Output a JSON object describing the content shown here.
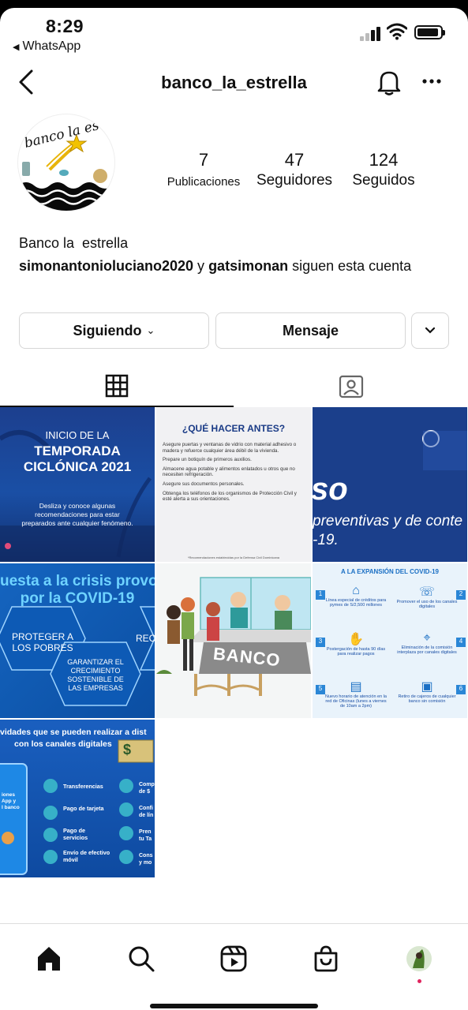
{
  "status_bar": {
    "time": "8:29",
    "back_app": "WhatsApp"
  },
  "header": {
    "username": "banco_la_estrella"
  },
  "profile": {
    "avatar_text": "banco la estrella",
    "stats": [
      {
        "value": "7",
        "label": "Publicaciones"
      },
      {
        "value": "47",
        "label": "Seguidores"
      },
      {
        "value": "124",
        "label": "Seguidos"
      }
    ],
    "name": "Banco la  estrella",
    "followed_by": {
      "user1": "simonantonioluciano2020",
      "connector": " y ",
      "user2": "gatsimonan",
      "suffix": " siguen esta cuenta"
    }
  },
  "buttons": {
    "following": "Siguiendo",
    "message": "Mensaje"
  },
  "posts": {
    "p1": {
      "line1": "INICIO DE LA",
      "line2": "TEMPORADA",
      "line3": "CICLÓNICA 2021",
      "body1": "Desliza y conoce algunas",
      "body2": "recomendaciones  para estar",
      "body3": "preparados ante cualquier fenómeno."
    },
    "p2": {
      "title": "¿QUÉ HACER ANTES?",
      "items": [
        "Asegure puertas y ventanas de vidrio con material adhesivo o madera y refuerce cualquier área débil de la vivienda.",
        "Prepare un botiquín de primeros auxilios.",
        "Almacene agua potable y alimentos enlatados u otros que no necesiten refrigeración.",
        "Asegure sus documentos personales.",
        "Obtenga los teléfonos de los organismos de Protección Civil y esté alerta a sus orientaciones."
      ],
      "footer": "*Recomendaciones establecidas por la Defensa Civil Dominicana"
    },
    "p3": {
      "big": "so",
      "line1": "preventivas y de conte",
      "line2": "-19."
    },
    "p4": {
      "title1": "uesta a la crisis provo",
      "title2": "por la COVID-19",
      "hex1": "PROTEGER A LOS POBRES",
      "hex2": "GARANTIZAR EL CRECIMIENTO SOSTENIBLE DE LAS EMPRESAS",
      "hex3": "REC"
    },
    "p5": {
      "sign": "BANCO"
    },
    "p6": {
      "title": "A LA EXPANSIÓN DEL COVID-19",
      "items": [
        {
          "n": "1",
          "text": "Línea especial de créditos para pymes de S/2,500 millones"
        },
        {
          "n": "2",
          "text": "Promover el uso de los canales digitales"
        },
        {
          "n": "3",
          "text": "Postergación de hasta 90 días para realizar pagos"
        },
        {
          "n": "4",
          "text": "Eliminación de la comisión interplaza por canales digitales"
        },
        {
          "n": "5",
          "text": "Nuevo horario de atención en la red de Oficinas (lunes a viernes de 10am a 2pm)"
        },
        {
          "n": "6",
          "text": "Retiro de cajeros de cualquier banco sin comisión"
        }
      ]
    },
    "p7": {
      "title1": "vidades que se pueden realizar a dist",
      "title2": "con los canales digitales",
      "phone1": "iones",
      "phone2": "App y",
      "phone3": "l banco",
      "items": [
        "Transferencias",
        "Pago de tarjeta",
        "Pago de servicios",
        "Envío de efectivo móvil"
      ],
      "items_right": [
        "Comp de $",
        "Confi de lín",
        "Pren tu Ta",
        "Cons y mo"
      ]
    }
  },
  "colors": {
    "ig_blue": "#0095f6",
    "post_navy": "#1b3f8b",
    "post_blue": "#1a6fc4"
  }
}
